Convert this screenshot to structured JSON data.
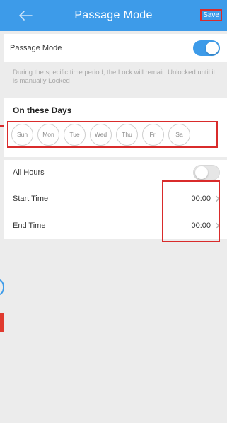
{
  "header": {
    "title": "Passage Mode",
    "save_label": "Save",
    "back_icon": "arrow-left-icon",
    "bar_color": "#3d9be9"
  },
  "passage_mode": {
    "label": "Passage Mode",
    "enabled": true,
    "description": "During the specific time period, the Lock will remain Unlocked until it is manually Locked"
  },
  "days": {
    "title": "On these Days",
    "items": [
      "Sun",
      "Mon",
      "Tue",
      "Wed",
      "Thu",
      "Fri",
      "Sa"
    ]
  },
  "hours": {
    "all_hours_label": "All Hours",
    "all_hours_enabled": false,
    "start_label": "Start Time",
    "start_value": "00:00",
    "end_label": "End Time",
    "end_value": "00:00"
  },
  "colors": {
    "accent": "#3d9be9",
    "highlight": "#d92b2b",
    "background": "#ececec"
  }
}
